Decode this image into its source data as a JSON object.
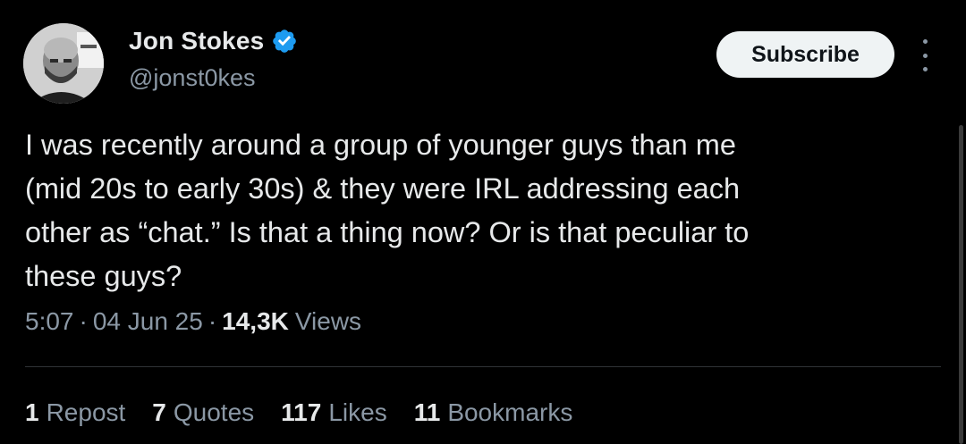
{
  "author": {
    "display_name": "Jon Stokes",
    "handle": "@jonst0kes",
    "verified_icon": "verified-badge-icon",
    "verified_color": "#1d9bf0"
  },
  "actions": {
    "subscribe_label": "Subscribe",
    "more_icon": "more-vertical-icon"
  },
  "tweet": {
    "text": "I was recently around a group of younger guys than me\n(mid 20s to early 30s) & they were IRL addressing each\nother as “chat.” Is that a thing now? Or is that peculiar to\nthese guys?",
    "time": "5:07",
    "date": "04 Jun 25",
    "separator": "·",
    "views_count": "14,3K",
    "views_label": "Views"
  },
  "stats": [
    {
      "count": "1",
      "label": "Repost"
    },
    {
      "count": "7",
      "label": "Quotes"
    },
    {
      "count": "117",
      "label": "Likes"
    },
    {
      "count": "11",
      "label": "Bookmarks"
    }
  ],
  "colors": {
    "background": "#000000",
    "primary_text": "#e7e9ea",
    "secondary_text": "#8b98a5",
    "button_bg": "#eff3f4",
    "divider": "#2f3336"
  }
}
